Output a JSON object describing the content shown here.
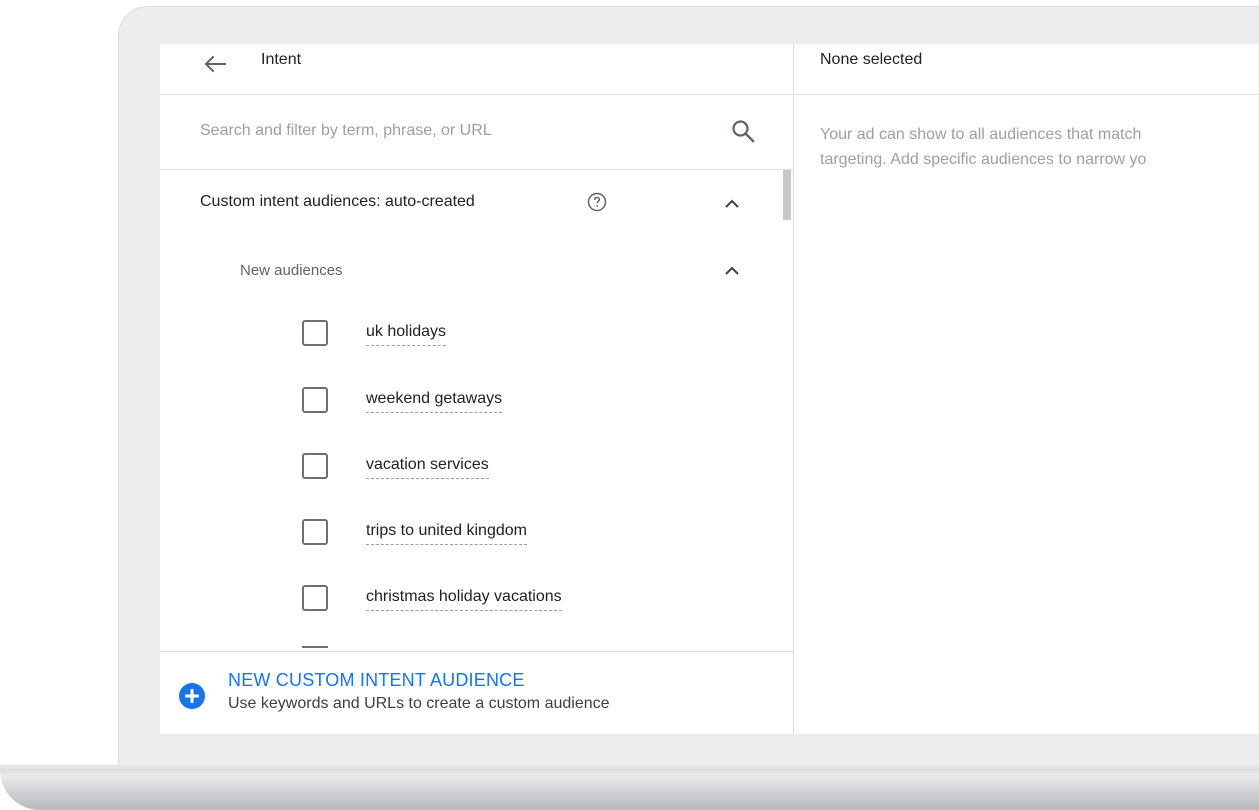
{
  "header": {
    "title": "Intent",
    "selection_title": "None selected"
  },
  "search": {
    "placeholder": "Search and filter by term, phrase, or URL",
    "value": ""
  },
  "section": {
    "label": "Custom intent audiences: auto-created",
    "subsection_label": "New audiences",
    "items": [
      {
        "label": "uk holidays",
        "checked": false
      },
      {
        "label": "weekend getaways",
        "checked": false
      },
      {
        "label": "vacation services",
        "checked": false
      },
      {
        "label": "trips to united kingdom",
        "checked": false
      },
      {
        "label": "christmas holiday vacations",
        "checked": false
      }
    ]
  },
  "footer": {
    "title": "NEW CUSTOM INTENT AUDIENCE",
    "subtitle": "Use keywords and URLs to create a custom audience"
  },
  "right_panel": {
    "line1": "Your ad can show to all audiences that match",
    "line2": "targeting. Add specific audiences to narrow yo"
  },
  "colors": {
    "accent": "#1a73e8",
    "text": "#202124",
    "muted": "#9aa0a6"
  },
  "icons": [
    "arrow-back-icon",
    "search-icon",
    "help-icon",
    "chevron-up-icon",
    "add-circle-icon"
  ]
}
